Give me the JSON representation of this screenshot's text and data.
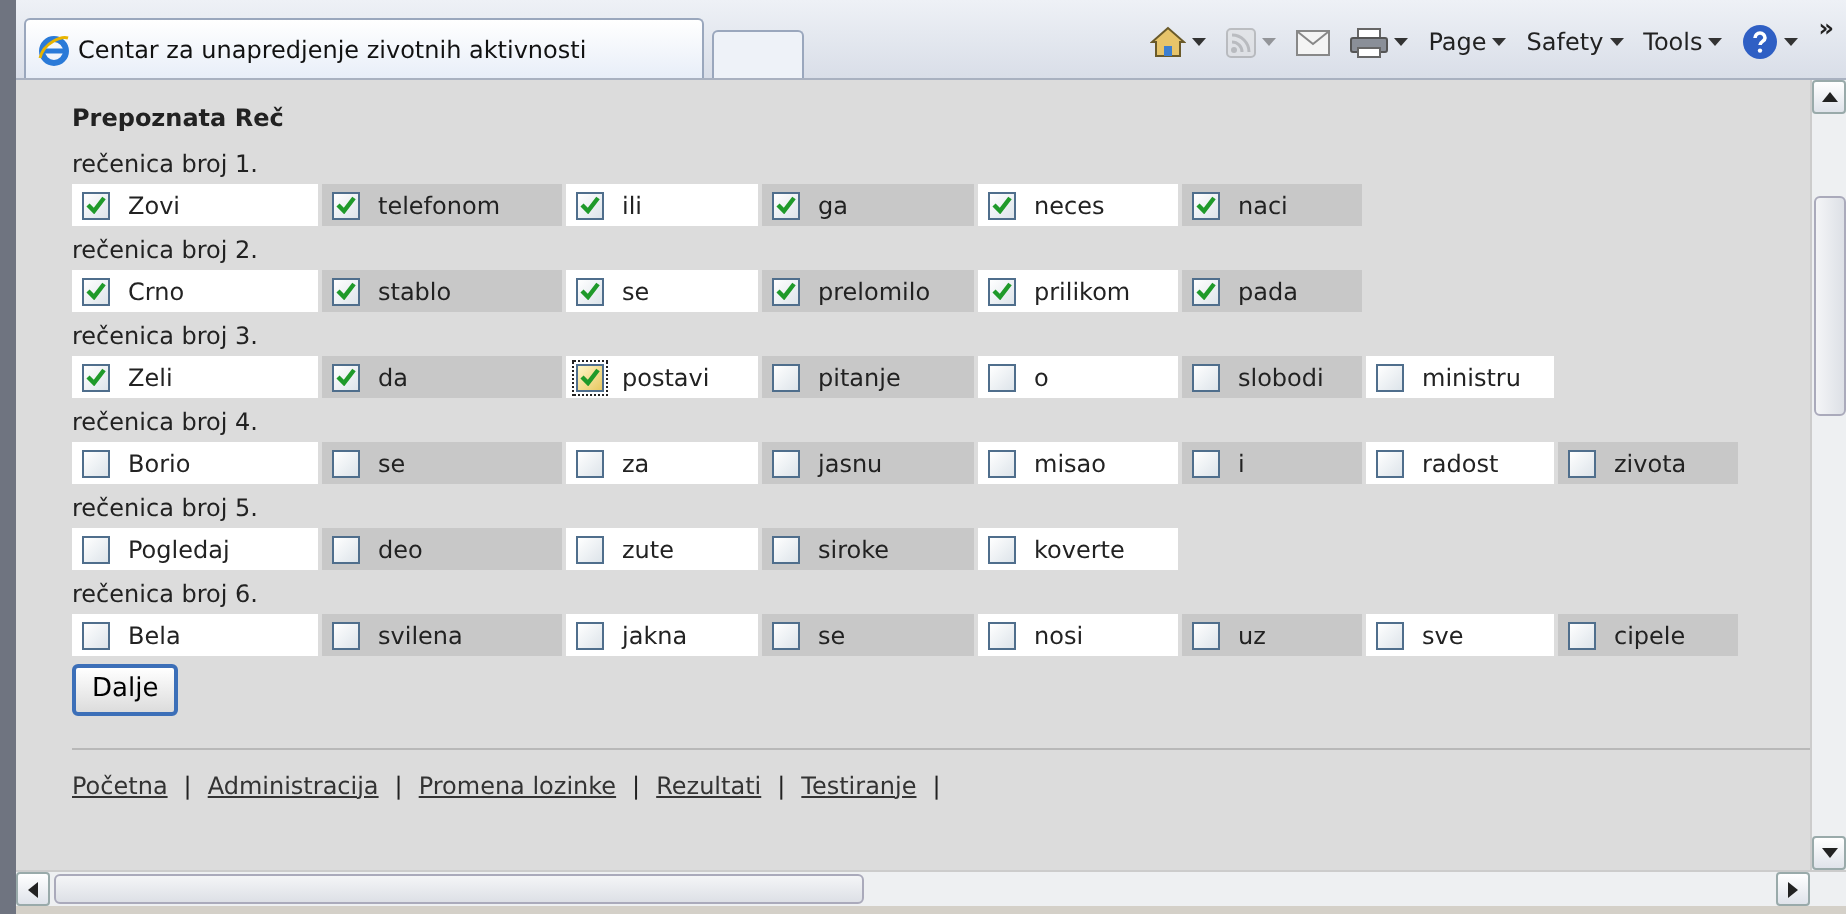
{
  "browser": {
    "tab_title": "Centar za unapredjenje zivotnih aktivnosti",
    "toolbar": [
      {
        "kind": "home",
        "dropdown": true,
        "disabled": false
      },
      {
        "kind": "feeds",
        "dropdown": true,
        "disabled": true
      },
      {
        "kind": "mail",
        "dropdown": false,
        "disabled": false
      },
      {
        "kind": "print",
        "dropdown": true,
        "disabled": false
      },
      {
        "kind": "menu",
        "label": "Page",
        "dropdown": true,
        "disabled": false
      },
      {
        "kind": "menu",
        "label": "Safety",
        "dropdown": true,
        "disabled": false
      },
      {
        "kind": "menu",
        "label": "Tools",
        "dropdown": true,
        "disabled": false
      },
      {
        "kind": "help",
        "dropdown": true,
        "disabled": false
      }
    ],
    "overflow": "»"
  },
  "heading": "Prepoznata Reč",
  "sentences": [
    {
      "label": "rečenica broj 1.",
      "words": [
        {
          "text": "Zovi",
          "checked": true,
          "focused": false
        },
        {
          "text": "telefonom",
          "checked": true,
          "focused": false
        },
        {
          "text": "ili",
          "checked": true,
          "focused": false
        },
        {
          "text": "ga",
          "checked": true,
          "focused": false
        },
        {
          "text": "neces",
          "checked": true,
          "focused": false
        },
        {
          "text": "naci",
          "checked": true,
          "focused": false
        }
      ]
    },
    {
      "label": "rečenica broj 2.",
      "words": [
        {
          "text": "Crno",
          "checked": true,
          "focused": false
        },
        {
          "text": "stablo",
          "checked": true,
          "focused": false
        },
        {
          "text": "se",
          "checked": true,
          "focused": false
        },
        {
          "text": "prelomilo",
          "checked": true,
          "focused": false
        },
        {
          "text": "prilikom",
          "checked": true,
          "focused": false
        },
        {
          "text": "pada",
          "checked": true,
          "focused": false
        }
      ]
    },
    {
      "label": "rečenica broj 3.",
      "words": [
        {
          "text": "Zeli",
          "checked": true,
          "focused": false
        },
        {
          "text": "da",
          "checked": true,
          "focused": false
        },
        {
          "text": "postavi",
          "checked": true,
          "focused": true
        },
        {
          "text": "pitanje",
          "checked": false,
          "focused": false
        },
        {
          "text": "o",
          "checked": false,
          "focused": false
        },
        {
          "text": "slobodi",
          "checked": false,
          "focused": false
        },
        {
          "text": "ministru",
          "checked": false,
          "focused": false
        }
      ]
    },
    {
      "label": "rečenica broj 4.",
      "words": [
        {
          "text": "Borio",
          "checked": false,
          "focused": false
        },
        {
          "text": "se",
          "checked": false,
          "focused": false
        },
        {
          "text": "za",
          "checked": false,
          "focused": false
        },
        {
          "text": "jasnu",
          "checked": false,
          "focused": false
        },
        {
          "text": "misao",
          "checked": false,
          "focused": false
        },
        {
          "text": "i",
          "checked": false,
          "focused": false
        },
        {
          "text": "radost",
          "checked": false,
          "focused": false
        },
        {
          "text": "zivota",
          "checked": false,
          "focused": false
        }
      ]
    },
    {
      "label": "rečenica broj 5.",
      "words": [
        {
          "text": "Pogledaj",
          "checked": false,
          "focused": false
        },
        {
          "text": "deo",
          "checked": false,
          "focused": false
        },
        {
          "text": "zute",
          "checked": false,
          "focused": false
        },
        {
          "text": "siroke",
          "checked": false,
          "focused": false
        },
        {
          "text": "koverte",
          "checked": false,
          "focused": false
        }
      ]
    },
    {
      "label": "rečenica broj 6.",
      "words": [
        {
          "text": "Bela",
          "checked": false,
          "focused": false
        },
        {
          "text": "svilena",
          "checked": false,
          "focused": false
        },
        {
          "text": "jakna",
          "checked": false,
          "focused": false
        },
        {
          "text": "se",
          "checked": false,
          "focused": false
        },
        {
          "text": "nosi",
          "checked": false,
          "focused": false
        },
        {
          "text": "uz",
          "checked": false,
          "focused": false
        },
        {
          "text": "sve",
          "checked": false,
          "focused": false
        },
        {
          "text": "cipele",
          "checked": false,
          "focused": false
        }
      ]
    }
  ],
  "submit": "Dalje",
  "footer_links": [
    "Početna",
    "Administracija",
    "Promena lozinke",
    "Rezultati",
    "Testiranje"
  ],
  "separator": "|"
}
